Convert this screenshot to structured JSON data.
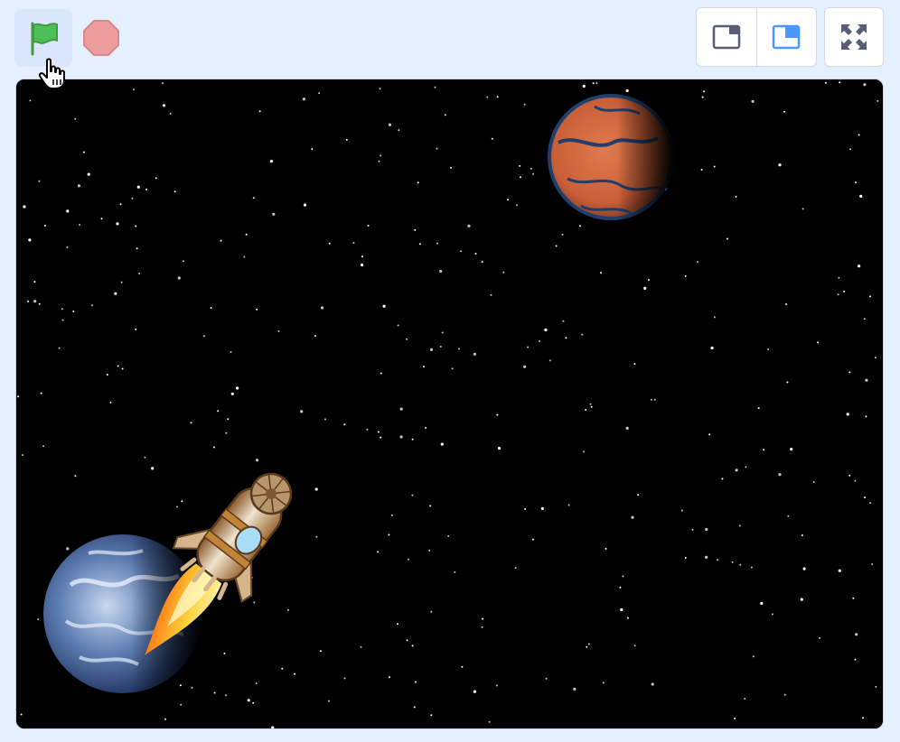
{
  "header": {
    "green_flag": {
      "icon": "green-flag-icon",
      "color": "#4cbf56"
    },
    "stop": {
      "icon": "stop-sign-icon",
      "color": "#ec9c9c"
    },
    "layout_small": {
      "icon": "small-stage-icon",
      "color": "#575e75"
    },
    "layout_normal": {
      "icon": "normal-stage-icon",
      "color": "#4c97ff",
      "selected": true
    },
    "fullscreen": {
      "icon": "fullscreen-icon",
      "color": "#575e75"
    }
  },
  "stage": {
    "backdrop": "starfield",
    "background_color": "#000000",
    "sprites": [
      {
        "name": "rocketship",
        "icon": "rocket-icon"
      },
      {
        "name": "earth",
        "icon": "earth-planet-icon"
      },
      {
        "name": "mars",
        "icon": "mars-planet-icon"
      }
    ]
  },
  "cursor": {
    "icon": "hand-pointer-icon"
  }
}
